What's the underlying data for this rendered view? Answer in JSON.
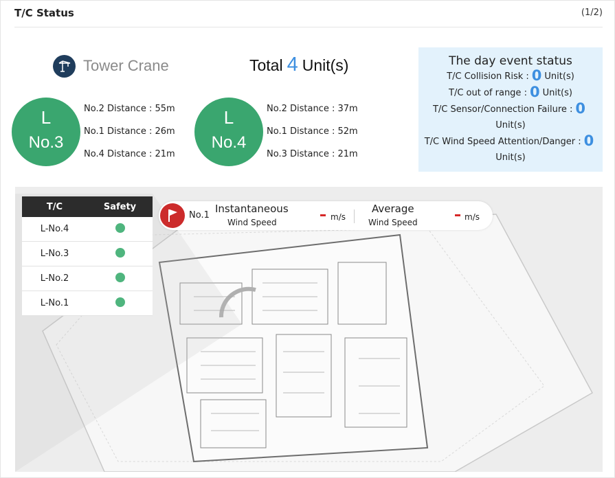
{
  "header": {
    "title": "T/C Status",
    "pager": "(1/2)"
  },
  "summary": {
    "label": "Tower Crane",
    "total_prefix": "Total",
    "total_count": "4",
    "total_suffix": "Unit(s)"
  },
  "cranes": [
    {
      "line1": "L",
      "line2": "No.3",
      "distances": [
        "No.2 Distance : 55m",
        "No.1 Distance : 26m",
        "No.4 Distance : 21m"
      ]
    },
    {
      "line1": "L",
      "line2": "No.4",
      "distances": [
        "No.2 Distance : 37m",
        "No.1 Distance : 52m",
        "No.3 Distance : 21m"
      ]
    }
  ],
  "events": {
    "title": "The day event status",
    "unit": "Unit(s)",
    "items": [
      {
        "label": "T/C Collision Risk :",
        "count": "0"
      },
      {
        "label": "T/C out of range :",
        "count": "0"
      },
      {
        "label": "T/C Sensor/Connection Failure :",
        "count": "0"
      },
      {
        "label": "T/C Wind Speed Attention/Danger :",
        "count": "0"
      }
    ]
  },
  "table": {
    "headers": [
      "T/C",
      "Safety"
    ],
    "rows": [
      "L-No.4",
      "L-No.3",
      "L-No.2",
      "L-No.1"
    ],
    "safety_color": "#4fb57e"
  },
  "wind": {
    "crane": "No.1",
    "inst_top": "Instantaneous",
    "inst_bottom": "Wind Speed",
    "avg_top": "Average",
    "avg_bottom": "Wind Speed",
    "unit": "m/s"
  },
  "colors": {
    "accent_blue": "#3d8fe0",
    "crane_green": "#3aa66f",
    "alert_red": "#cc2b2b",
    "event_bg": "#e3f2fc"
  }
}
